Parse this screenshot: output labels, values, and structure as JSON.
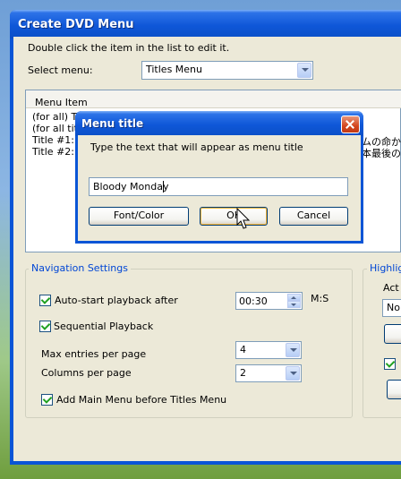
{
  "window": {
    "title": "Create DVD Menu",
    "instruction": "Double click the item in the list to edit it.",
    "select_menu_label": "Select menu:",
    "select_menu_value": "Titles Menu"
  },
  "list": {
    "header": "Menu Item",
    "rows": [
      "(for all) T",
      "(for all tit",
      "Title #1: \"",
      "Title #2: \""
    ],
    "right_fragments": [
      "ムの命か",
      "本最後の"
    ]
  },
  "navigation": {
    "group_title": "Navigation Settings",
    "autostart_label": "Auto-start playback after",
    "autostart_checked": true,
    "autostart_time": "00:30",
    "time_unit": "M:S",
    "sequential_label": "Sequential Playback",
    "sequential_checked": true,
    "max_entries_label": "Max entries per page",
    "max_entries_value": "4",
    "columns_label": "Columns per page",
    "columns_value": "2",
    "add_main_label": "Add Main Menu before Titles Menu",
    "add_main_checked": true
  },
  "highlight": {
    "group_title": "Highlig",
    "act_label": "Act",
    "dropdown_fragment": "No"
  },
  "dialog": {
    "title": "Menu title",
    "prompt": "Type the text that will appear as menu title",
    "input_value": "Bloody Monday",
    "font_button": "Font/Color",
    "ok_button": "OK",
    "cancel_button": "Cancel"
  },
  "icons": {
    "close": "close-icon",
    "cursor": "mouse-cursor-icon",
    "dropdown": "chevron-down-icon"
  }
}
